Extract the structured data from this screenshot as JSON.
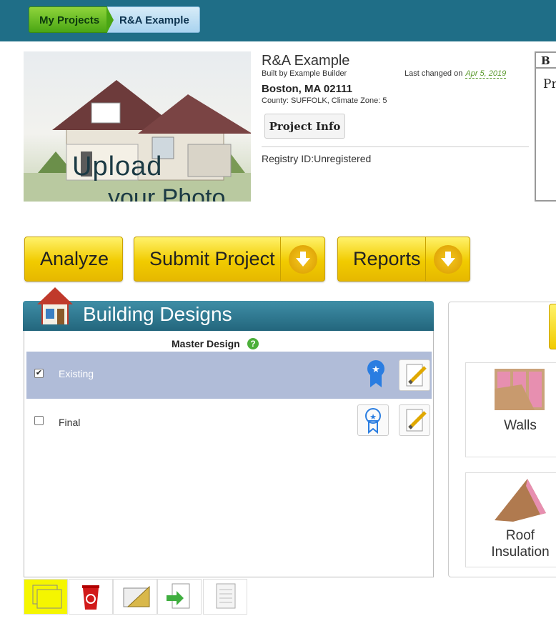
{
  "breadcrumb": {
    "item1": "My Projects",
    "item2": "R&A Example"
  },
  "photo": {
    "line1": "Upload",
    "line2": "your Photo"
  },
  "project": {
    "name": "R&A Example",
    "builder": "Built by Example Builder",
    "changed_label": "Last changed on",
    "changed_date": "Apr 5, 2019",
    "city": "Boston, MA 02111",
    "county": "County: SUFFOLK, Climate Zone: 5",
    "info_button": "Project Info",
    "registry": "Registry ID:Unregistered"
  },
  "side_panel": {
    "header": "B",
    "body": "Pr"
  },
  "actions": {
    "analyze": "Analyze",
    "submit": "Submit Project",
    "reports": "Reports"
  },
  "designs": {
    "title": "Building Designs",
    "master_label": "Master Design",
    "rows": [
      {
        "label": "Existing",
        "checked": true,
        "selected": true
      },
      {
        "label": "Final",
        "checked": false,
        "selected": false
      }
    ]
  },
  "components": {
    "walls": "Walls",
    "roof_line1": "Roof",
    "roof_line2": "Insulation"
  },
  "toolbar": {
    "icons": [
      "compare-icon",
      "trash-icon",
      "ruler-icon",
      "export-icon",
      "report-icon"
    ]
  },
  "colors": {
    "topbar": "#1f6e87",
    "accent_yellow": "#f1cb00",
    "selected_row": "#b0bcd8",
    "header_teal": "#2b7690"
  }
}
